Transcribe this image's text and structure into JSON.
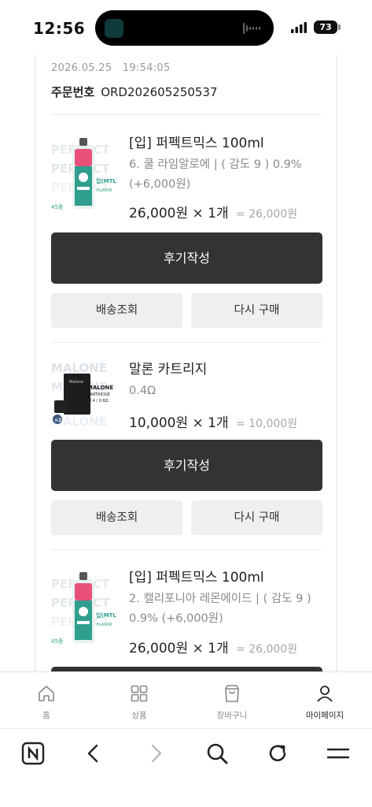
{
  "status_bar": {
    "time": "12:56",
    "battery": "73"
  },
  "order": {
    "date": "2026.05.25",
    "time": "19:54:05",
    "number_label": "주문번호",
    "number": "ORD202605250537"
  },
  "items": [
    {
      "name": "[입] 퍼펙트믹스 100ml",
      "option": "6. 쿨 라임알로에 | ( 감도 9 ) 0.9% (+6,000원)",
      "price_qty": "26,000원 × 1개",
      "total": "= 26,000원",
      "review_label": "후기작성",
      "track_label": "배송조회",
      "rebuy_label": "다시 구매"
    },
    {
      "name": "말론 카트리지",
      "option": "0.4Ω",
      "price_qty": "10,000원 × 1개",
      "total": "= 10,000원",
      "review_label": "후기작성",
      "track_label": "배송조회",
      "rebuy_label": "다시 구매"
    },
    {
      "name": "[입] 퍼펙트믹스 100ml",
      "option": "2. 캘리포니아 레몬에이드 | ( 감도 9 ) 0.9% (+6,000원)",
      "price_qty": "26,000원 × 1개",
      "total": "= 26,000원"
    }
  ],
  "bottom_nav": [
    {
      "label": "홈",
      "icon": "home-icon"
    },
    {
      "label": "상품",
      "icon": "grid-icon"
    },
    {
      "label": "장바구니",
      "icon": "shopping-bag-icon"
    },
    {
      "label": "마이페이지",
      "icon": "user-icon",
      "active": true
    }
  ],
  "browser_bar": [
    "naver-n-icon",
    "back-chevron-icon",
    "forward-chevron-icon",
    "search-icon",
    "refresh-icon",
    "menu-icon"
  ],
  "colors": {
    "dark_button": "#333333",
    "light_button": "#efefef",
    "muted_text": "#8a8a8a"
  }
}
